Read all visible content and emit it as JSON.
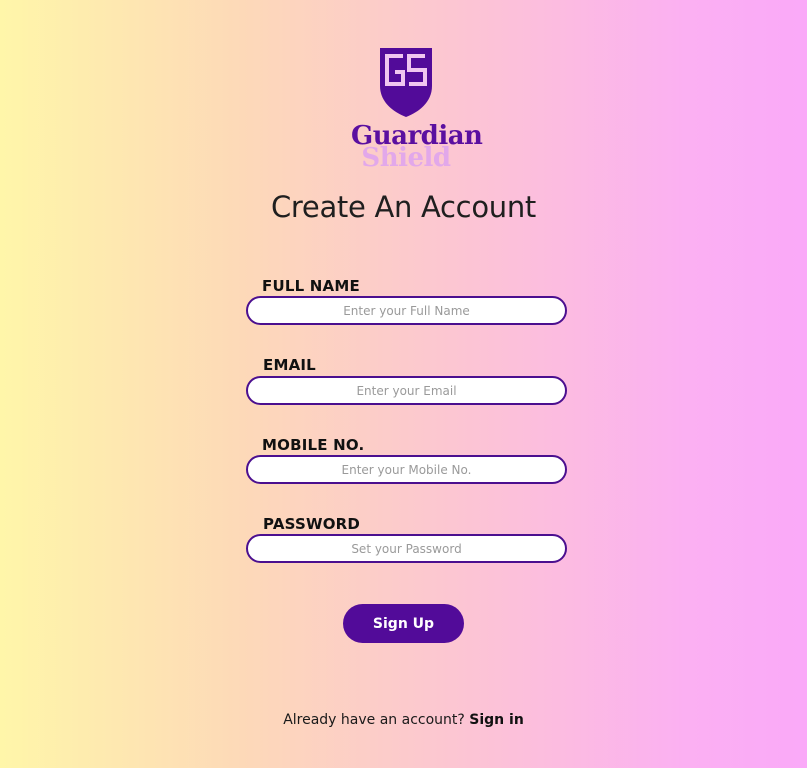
{
  "brand": {
    "line1": "Guardian",
    "line2": "Shield",
    "icon": "shield-icon",
    "monogram": "GS",
    "primary_color": "#520b99",
    "secondary_color": "#e2a8ea"
  },
  "page": {
    "title": "Create An Account"
  },
  "form": {
    "full_name": {
      "label": "FULL NAME",
      "placeholder": "Enter your Full Name",
      "value": ""
    },
    "email": {
      "label": "EMAIL",
      "placeholder": "Enter your Email",
      "value": ""
    },
    "mobile": {
      "label": "MOBILE NO.",
      "placeholder": "Enter your Mobile No.",
      "value": ""
    },
    "password": {
      "label": "PASSWORD",
      "placeholder": "Set your Password",
      "value": ""
    },
    "submit_label": "Sign Up"
  },
  "footer": {
    "prompt": "Already have an account?",
    "link": "Sign in"
  }
}
